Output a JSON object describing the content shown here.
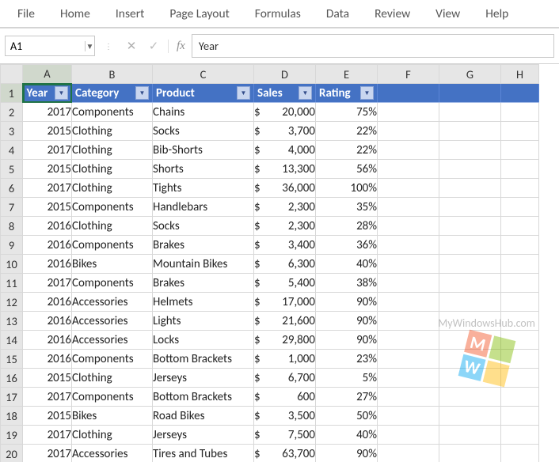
{
  "ribbon": {
    "tabs": [
      "File",
      "Home",
      "Insert",
      "Page Layout",
      "Formulas",
      "Data",
      "Review",
      "View",
      "Help"
    ]
  },
  "formula_bar": {
    "namebox": "A1",
    "fx_label": "fx",
    "formula_value": "Year"
  },
  "watermark": "MyWindowsHub.com",
  "sheet": {
    "col_labels": [
      "A",
      "B",
      "C",
      "D",
      "E",
      "F",
      "G",
      "H"
    ],
    "row_labels": [
      "1",
      "2",
      "3",
      "4",
      "5",
      "6",
      "7",
      "8",
      "9",
      "10",
      "11",
      "12",
      "13",
      "14",
      "15",
      "16",
      "17",
      "18",
      "19",
      "20"
    ],
    "active_cell": "A1",
    "headers": [
      "Year",
      "Category",
      "Product",
      "Sales",
      "Rating"
    ],
    "rows": [
      {
        "year": "2017",
        "category": "Components",
        "product": "Chains",
        "sales": "20,000",
        "rating": "75%"
      },
      {
        "year": "2015",
        "category": "Clothing",
        "product": "Socks",
        "sales": "3,700",
        "rating": "22%"
      },
      {
        "year": "2017",
        "category": "Clothing",
        "product": "Bib-Shorts",
        "sales": "4,000",
        "rating": "22%"
      },
      {
        "year": "2015",
        "category": "Clothing",
        "product": "Shorts",
        "sales": "13,300",
        "rating": "56%"
      },
      {
        "year": "2017",
        "category": "Clothing",
        "product": "Tights",
        "sales": "36,000",
        "rating": "100%"
      },
      {
        "year": "2015",
        "category": "Components",
        "product": "Handlebars",
        "sales": "2,300",
        "rating": "35%"
      },
      {
        "year": "2016",
        "category": "Clothing",
        "product": "Socks",
        "sales": "2,300",
        "rating": "28%"
      },
      {
        "year": "2016",
        "category": "Components",
        "product": "Brakes",
        "sales": "3,400",
        "rating": "36%"
      },
      {
        "year": "2016",
        "category": "Bikes",
        "product": "Mountain Bikes",
        "sales": "6,300",
        "rating": "40%"
      },
      {
        "year": "2017",
        "category": "Components",
        "product": "Brakes",
        "sales": "5,400",
        "rating": "38%"
      },
      {
        "year": "2016",
        "category": "Accessories",
        "product": "Helmets",
        "sales": "17,000",
        "rating": "90%"
      },
      {
        "year": "2016",
        "category": "Accessories",
        "product": "Lights",
        "sales": "21,600",
        "rating": "90%"
      },
      {
        "year": "2016",
        "category": "Accessories",
        "product": "Locks",
        "sales": "29,800",
        "rating": "90%"
      },
      {
        "year": "2016",
        "category": "Components",
        "product": "Bottom Brackets",
        "sales": "1,000",
        "rating": "23%"
      },
      {
        "year": "2015",
        "category": "Clothing",
        "product": "Jerseys",
        "sales": "6,700",
        "rating": "5%"
      },
      {
        "year": "2017",
        "category": "Components",
        "product": "Bottom Brackets",
        "sales": "600",
        "rating": "27%"
      },
      {
        "year": "2015",
        "category": "Bikes",
        "product": "Road Bikes",
        "sales": "3,500",
        "rating": "50%"
      },
      {
        "year": "2017",
        "category": "Clothing",
        "product": "Jerseys",
        "sales": "7,500",
        "rating": "40%"
      },
      {
        "year": "2017",
        "category": "Accessories",
        "product": "Tires and Tubes",
        "sales": "63,700",
        "rating": "90%"
      }
    ]
  }
}
